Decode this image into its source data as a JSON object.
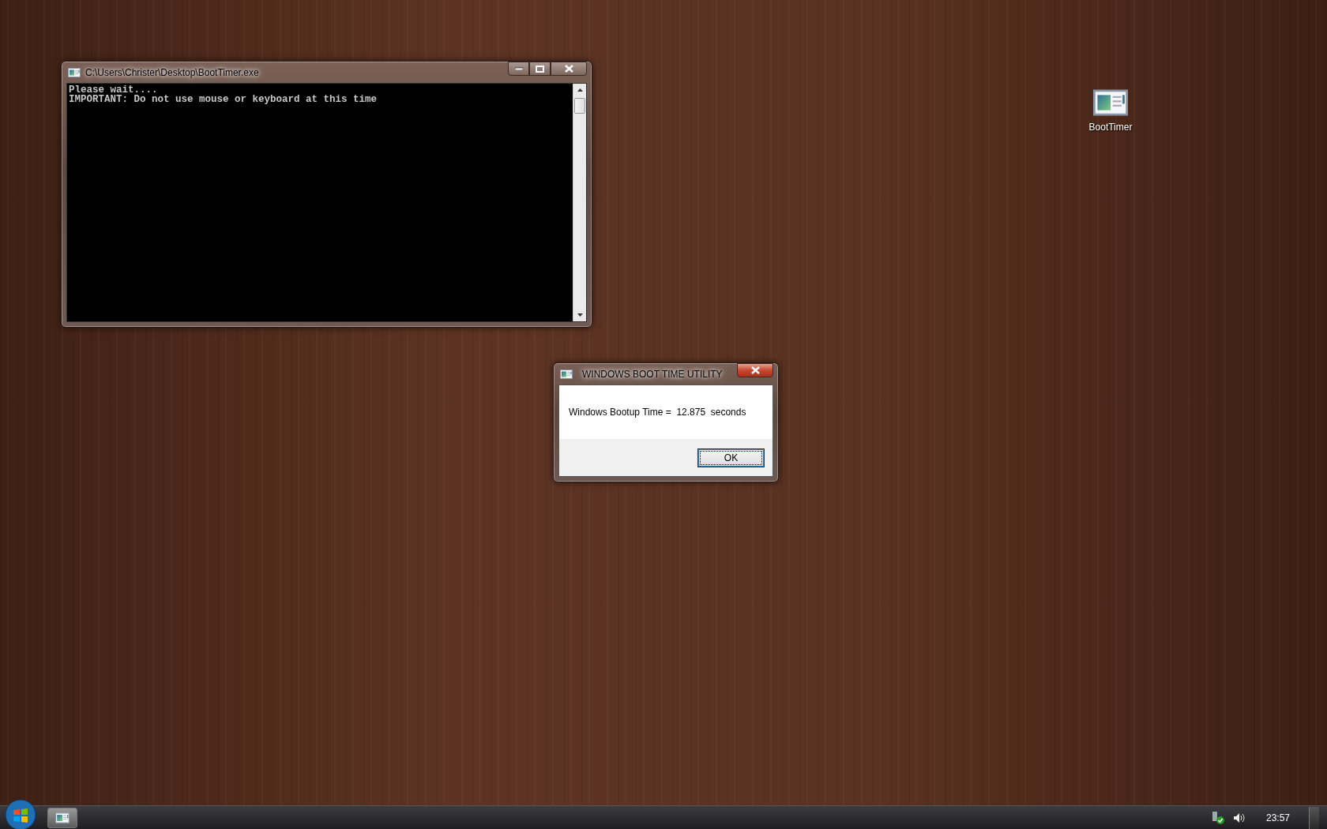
{
  "console_window": {
    "title": "C:\\Users\\Christer\\Desktop\\BootTimer.exe",
    "lines": [
      "Please wait....",
      "IMPORTANT: Do not use mouse or keyboard at this time"
    ]
  },
  "dialog": {
    "title": "WINDOWS BOOT TIME UTILITY",
    "message": "Windows Bootup Time =  12.875  seconds",
    "buttons": [
      "OK"
    ]
  },
  "desktop_icons": [
    {
      "label": "BootTimer"
    }
  ],
  "taskbar": {
    "clock": "23:57"
  }
}
